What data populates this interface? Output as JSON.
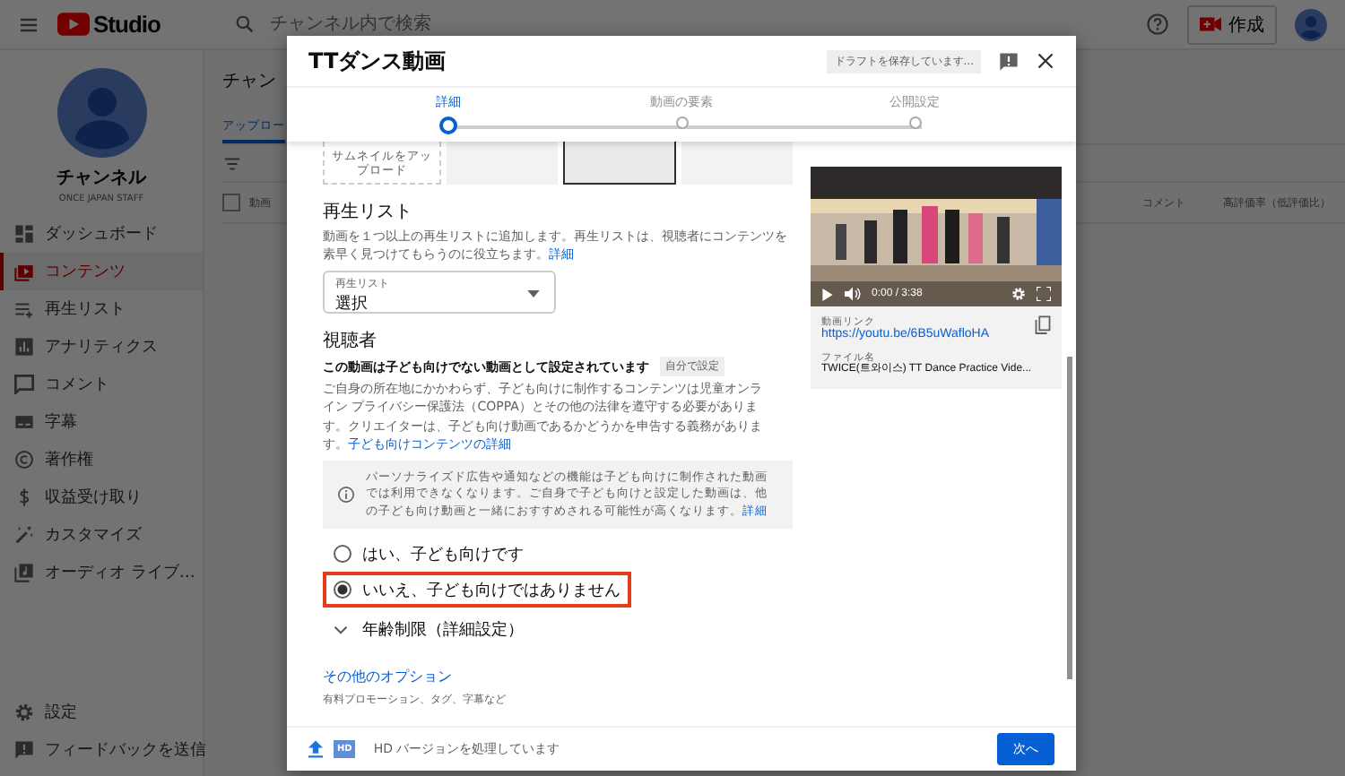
{
  "topbar": {
    "logo": "Studio",
    "search": {
      "placeholder": "チャンネル内で検索"
    },
    "create_button": "作成"
  },
  "sidebar": {
    "channel_name": "チャンネル",
    "channel_handle": "ONCE JAPAN STAFF",
    "items": [
      {
        "label": "ダッシュボード",
        "selected": false
      },
      {
        "label": "コンテンツ",
        "selected": true
      },
      {
        "label": "再生リスト",
        "selected": false
      },
      {
        "label": "アナリティクス",
        "selected": false
      },
      {
        "label": "コメント",
        "selected": false
      },
      {
        "label": "字幕",
        "selected": false
      },
      {
        "label": "著作権",
        "selected": false
      },
      {
        "label": "収益受け取り",
        "selected": false
      },
      {
        "label": "カスタマイズ",
        "selected": false
      },
      {
        "label": "オーディオ ライブ…",
        "selected": false
      }
    ],
    "bottom_items": [
      {
        "label": "設定"
      },
      {
        "label": "フィードバックを送信"
      }
    ]
  },
  "main": {
    "title": "チャン",
    "tab": "アップロー",
    "select_all": {
      "checked": false
    },
    "columns": [
      "動画",
      "コメント",
      "高評価率（低評価比）"
    ]
  },
  "dialog": {
    "title": "TTダンス動画",
    "save_status": "ドラフトを保存しています...",
    "steps": [
      {
        "label": "詳細",
        "selected": true
      },
      {
        "label": "動画の要素",
        "selected": false
      },
      {
        "label": "公開設定",
        "selected": false
      }
    ],
    "thumbnail_upload": "サムネイルをアップロード",
    "playlist": {
      "heading": "再生リスト",
      "description": "動画を１つ以上の再生リストに追加します。再生リストは、視聴者にコンテンツを素早く見つけてもらうのに役立ちます。",
      "link": "詳細",
      "dropdown_label": "再生リスト",
      "dropdown_value": "選択"
    },
    "audience": {
      "heading": "視聴者",
      "status": "この動画は子ども向けでない動画として設定されています",
      "badge": "自分で設定",
      "description": "ご自身の所在地にかかわらず、子ども向けに制作するコンテンツは児童オンライン プライバシー保護法（COPPA）とその他の法律を遵守する必要があります。クリエイターは、子ども向け動画であるかどうかを申告する義務があります。",
      "link": "子ども向けコンテンツの詳細",
      "info": "パーソナライズド広告や通知などの機能は子ども向けに制作された動画では利用できなくなります。ご自身で子ども向けと設定した動画は、他の子ども向け動画と一緒におすすめされる可能性が高くなります。",
      "info_link": "詳細",
      "options": [
        {
          "label": "はい、子ども向けです",
          "selected": false,
          "highlighted": false
        },
        {
          "label": "いいえ、子ども向けではありません",
          "selected": true,
          "highlighted": true
        }
      ]
    },
    "age_restriction": {
      "label": "年齢制限（詳細設定）",
      "expanded": false
    },
    "more_options": {
      "link": "その他のオプション",
      "description": "有料プロモーション、タグ、字幕など"
    },
    "video": {
      "time": "0:00 / 3:38",
      "link_label": "動画リンク",
      "link": "https://youtu.be/6B5uWafloHA",
      "file_label": "ファイル名",
      "file_name": "TWICE(트와이스) TT Dance Practice Vide..."
    },
    "footer": {
      "hd_badge": "HD",
      "status": "HD バージョンを処理しています",
      "next_button": "次へ"
    }
  }
}
